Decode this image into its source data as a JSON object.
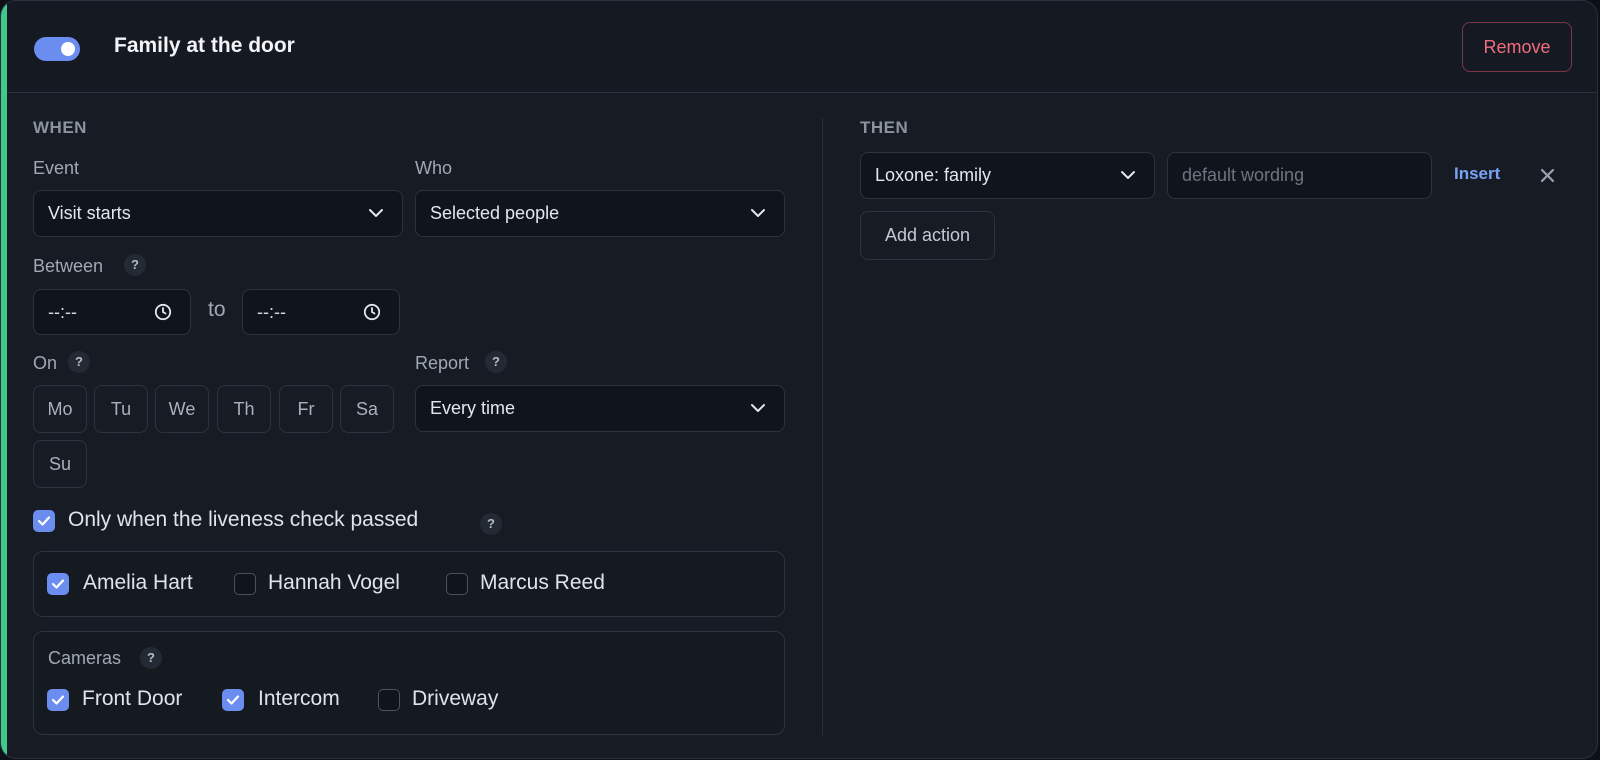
{
  "rule": {
    "enabled": true,
    "title": "Family at the door",
    "remove_label": "Remove"
  },
  "when": {
    "heading": "WHEN",
    "event": {
      "label": "Event",
      "value": "Visit starts"
    },
    "who": {
      "label": "Who",
      "value": "Selected people"
    },
    "between": {
      "label": "Between",
      "help": "?",
      "from_value": "--:--",
      "to_text": "to",
      "to_value": "--:--"
    },
    "on": {
      "label": "On",
      "help": "?",
      "days": [
        "Mo",
        "Tu",
        "We",
        "Th",
        "Fr",
        "Sa",
        "Su"
      ]
    },
    "report": {
      "label": "Report",
      "help": "?",
      "value": "Every time"
    },
    "liveness": {
      "label": "Only when the liveness check passed",
      "help": "?",
      "checked": true
    },
    "people": [
      {
        "name": "Amelia Hart",
        "checked": true
      },
      {
        "name": "Hannah Vogel",
        "checked": false
      },
      {
        "name": "Marcus Reed",
        "checked": false
      }
    ],
    "cameras": {
      "label": "Cameras",
      "help": "?",
      "items": [
        {
          "name": "Front Door",
          "checked": true
        },
        {
          "name": "Intercom",
          "checked": true
        },
        {
          "name": "Driveway",
          "checked": false
        }
      ]
    }
  },
  "then": {
    "heading": "THEN",
    "action": {
      "value": "Loxone: family",
      "wording_placeholder": "default wording",
      "insert_label": "Insert"
    },
    "add_action_label": "Add action"
  },
  "colors": {
    "accent_stripe": "#3fc98a",
    "toggle_on": "#6b8df0",
    "checkbox_on": "#6b8df0",
    "danger": "#f06d7f",
    "link": "#79a2f4"
  }
}
